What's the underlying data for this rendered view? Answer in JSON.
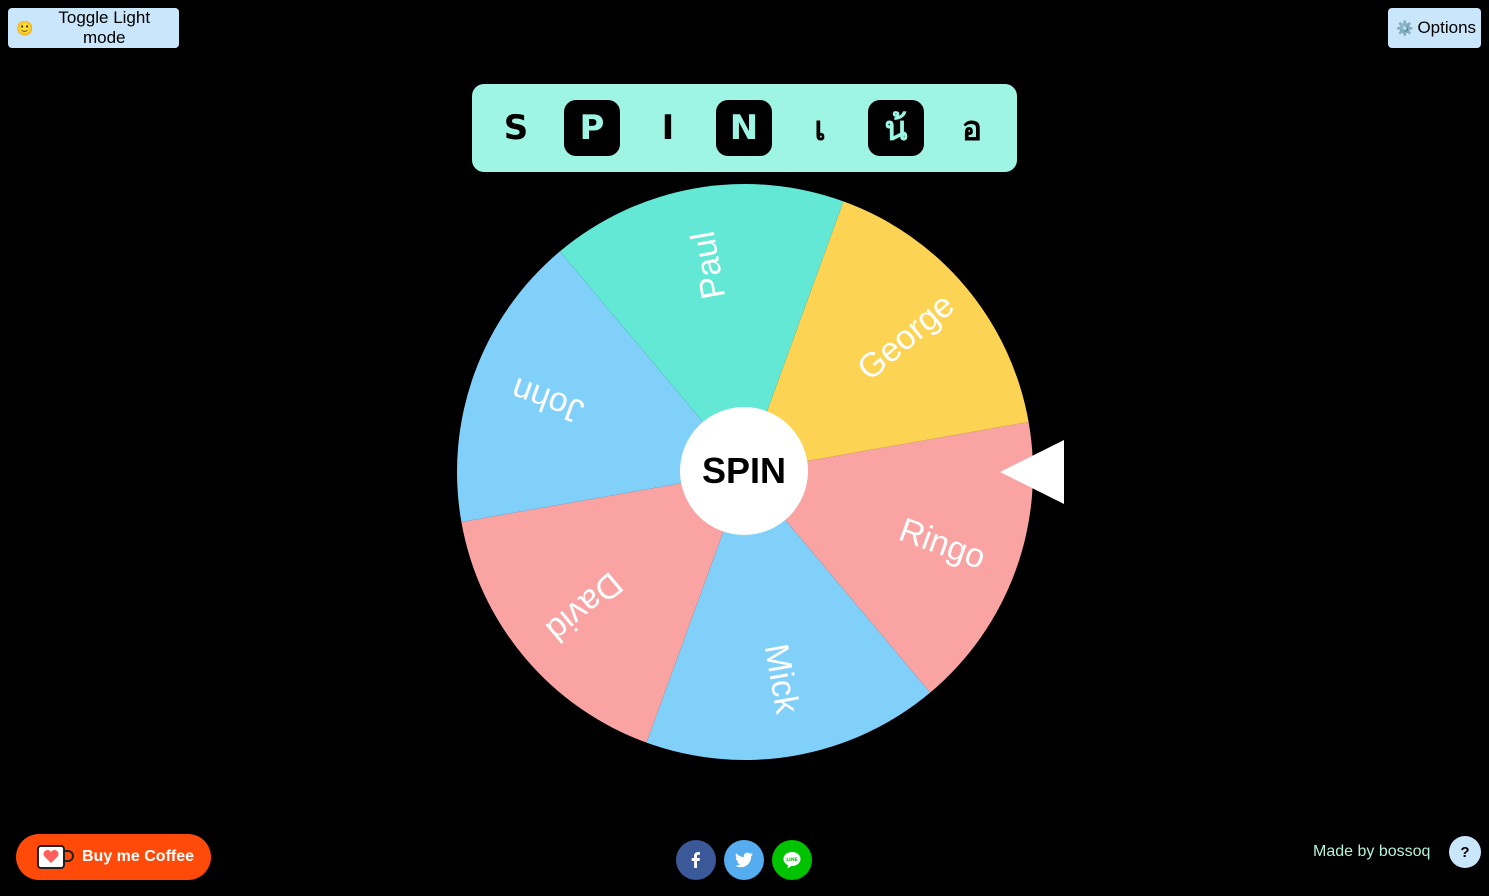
{
  "header": {
    "toggle_label": "Toggle Light mode",
    "toggle_emoji": "🙂",
    "options_label": "Options",
    "options_emoji": "⚙️"
  },
  "logo": {
    "letters": [
      "S",
      "P",
      "I",
      "N",
      "เ",
      "น้",
      "อ"
    ],
    "boxed": [
      false,
      true,
      false,
      true,
      false,
      true,
      false
    ],
    "colors": {
      "background": "#9ff5e3",
      "box": "#000000"
    }
  },
  "wheel": {
    "spin_label": "SPIN",
    "pointer_color": "#ffffff",
    "segments": [
      {
        "name": "Ringo",
        "color": "#f9a3a3"
      },
      {
        "name": "Mick",
        "color": "#80d0fa"
      },
      {
        "name": "David",
        "color": "#f9a3a3"
      },
      {
        "name": "John",
        "color": "#80d0fa"
      },
      {
        "name": "Paul",
        "color": "#62e8d5"
      },
      {
        "name": "George",
        "color": "#fdd353"
      }
    ]
  },
  "footer": {
    "coffee_label": "Buy me Coffee",
    "share_icons": [
      "facebook-icon",
      "twitter-icon",
      "line-icon"
    ],
    "credit": "Made by bossoq",
    "help_label": "?"
  },
  "colors": {
    "background": "#000000",
    "button_bg": "#c9e6fb",
    "coffee": "#ff4a0a",
    "credit_text": "#b5f0dd"
  }
}
